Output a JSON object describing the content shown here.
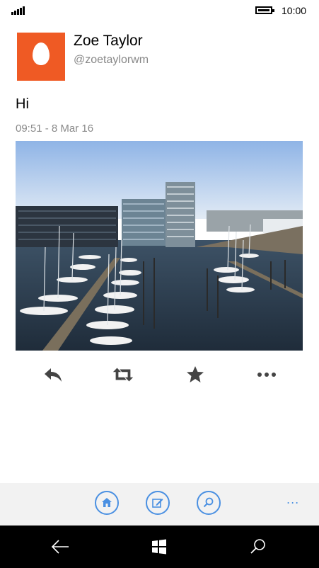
{
  "status_bar": {
    "time": "10:00"
  },
  "tweet": {
    "author_name": "Zoe Taylor",
    "author_handle": "@zoetaylorwm",
    "text": "Hi",
    "timestamp": "09:51 - 8 Mar 16"
  },
  "actions": [
    "reply-icon",
    "retweet-icon",
    "favorite-icon",
    "more-icon"
  ],
  "app_bar": {
    "buttons": [
      "home-icon",
      "compose-icon",
      "search-icon"
    ],
    "more": "..."
  },
  "colors": {
    "accent": "#4a90e2",
    "avatar_bg": "#ef5a24",
    "timestamp": "#8a8a8a"
  }
}
